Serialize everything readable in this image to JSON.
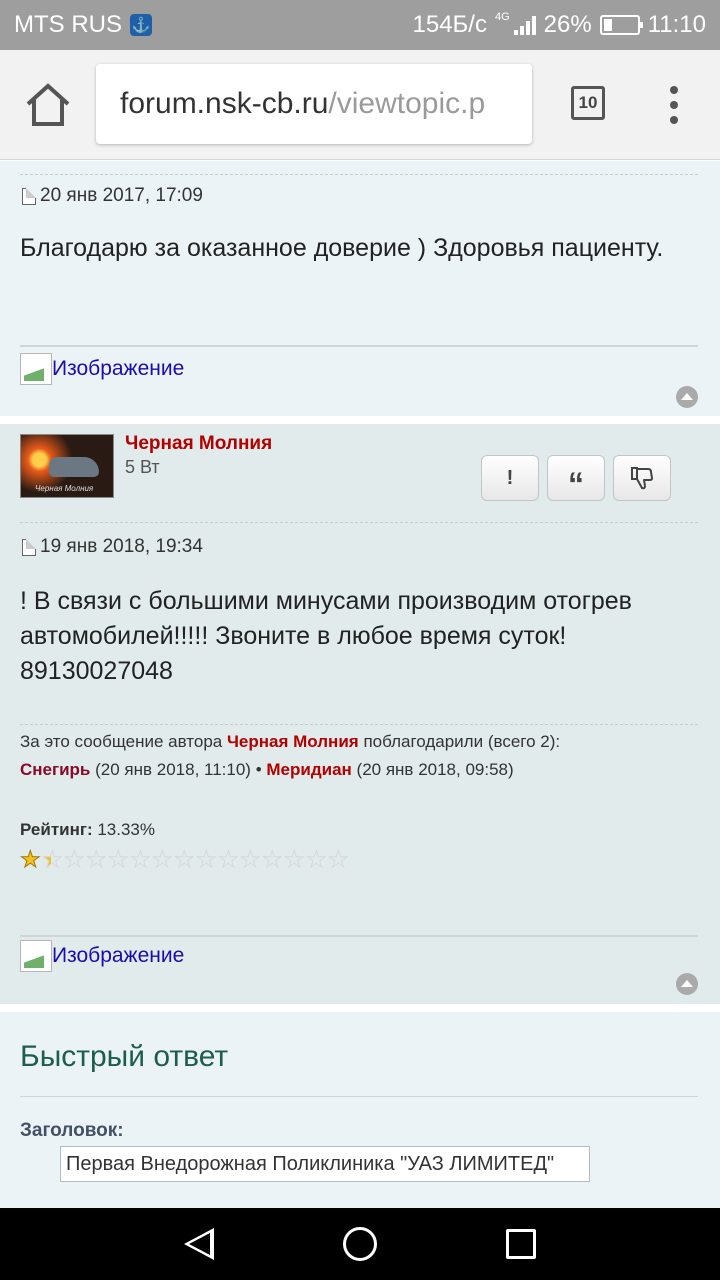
{
  "status_bar": {
    "carrier": "MTS RUS",
    "speed": "154Б/с",
    "network": "4G",
    "battery_text": "26%",
    "battery_level": 0.26,
    "time": "11:10"
  },
  "browser": {
    "url_host": "forum.nsk-cb.ru",
    "url_path": "/viewtopic.p",
    "tab_count": "10"
  },
  "post1": {
    "date": "20 янв 2017, 17:09",
    "text": "Благодарю за оказанное доверие ) Здоровья пациенту.",
    "image_alt": "Изображение"
  },
  "post2": {
    "author": "Черная Молния",
    "rank": "5 Вт",
    "avatar_caption": "Черная Молния",
    "buttons": {
      "report": "!",
      "quote": "“",
      "dislike": "👎"
    },
    "date": "19 янв 2018, 19:34",
    "text": "! В связи с большими минусами производим отогрев автомобилей!!!!! Звоните в любое время суток! 89130027048",
    "thanks": {
      "prefix": "За это сообщение автора",
      "author": "Черная Молния",
      "suffix": "поблагодарили (всего 2):",
      "user1": "Снегирь",
      "user1_date": "(20 янв 2018, 11:10)",
      "sep": "•",
      "user2": "Меридиан",
      "user2_date": "(20 янв 2018, 09:58)"
    },
    "rating_label": "Рейтинг:",
    "rating_value": "13.33%",
    "rating_fraction": 0.1333,
    "stars_total": 15,
    "image_alt": "Изображение"
  },
  "quick_reply": {
    "title": "Быстрый ответ",
    "subject_label": "Заголовок:",
    "subject_value": "Первая Внедорожная Поликлиника \"УАЗ ЛИМИТЕД\""
  }
}
